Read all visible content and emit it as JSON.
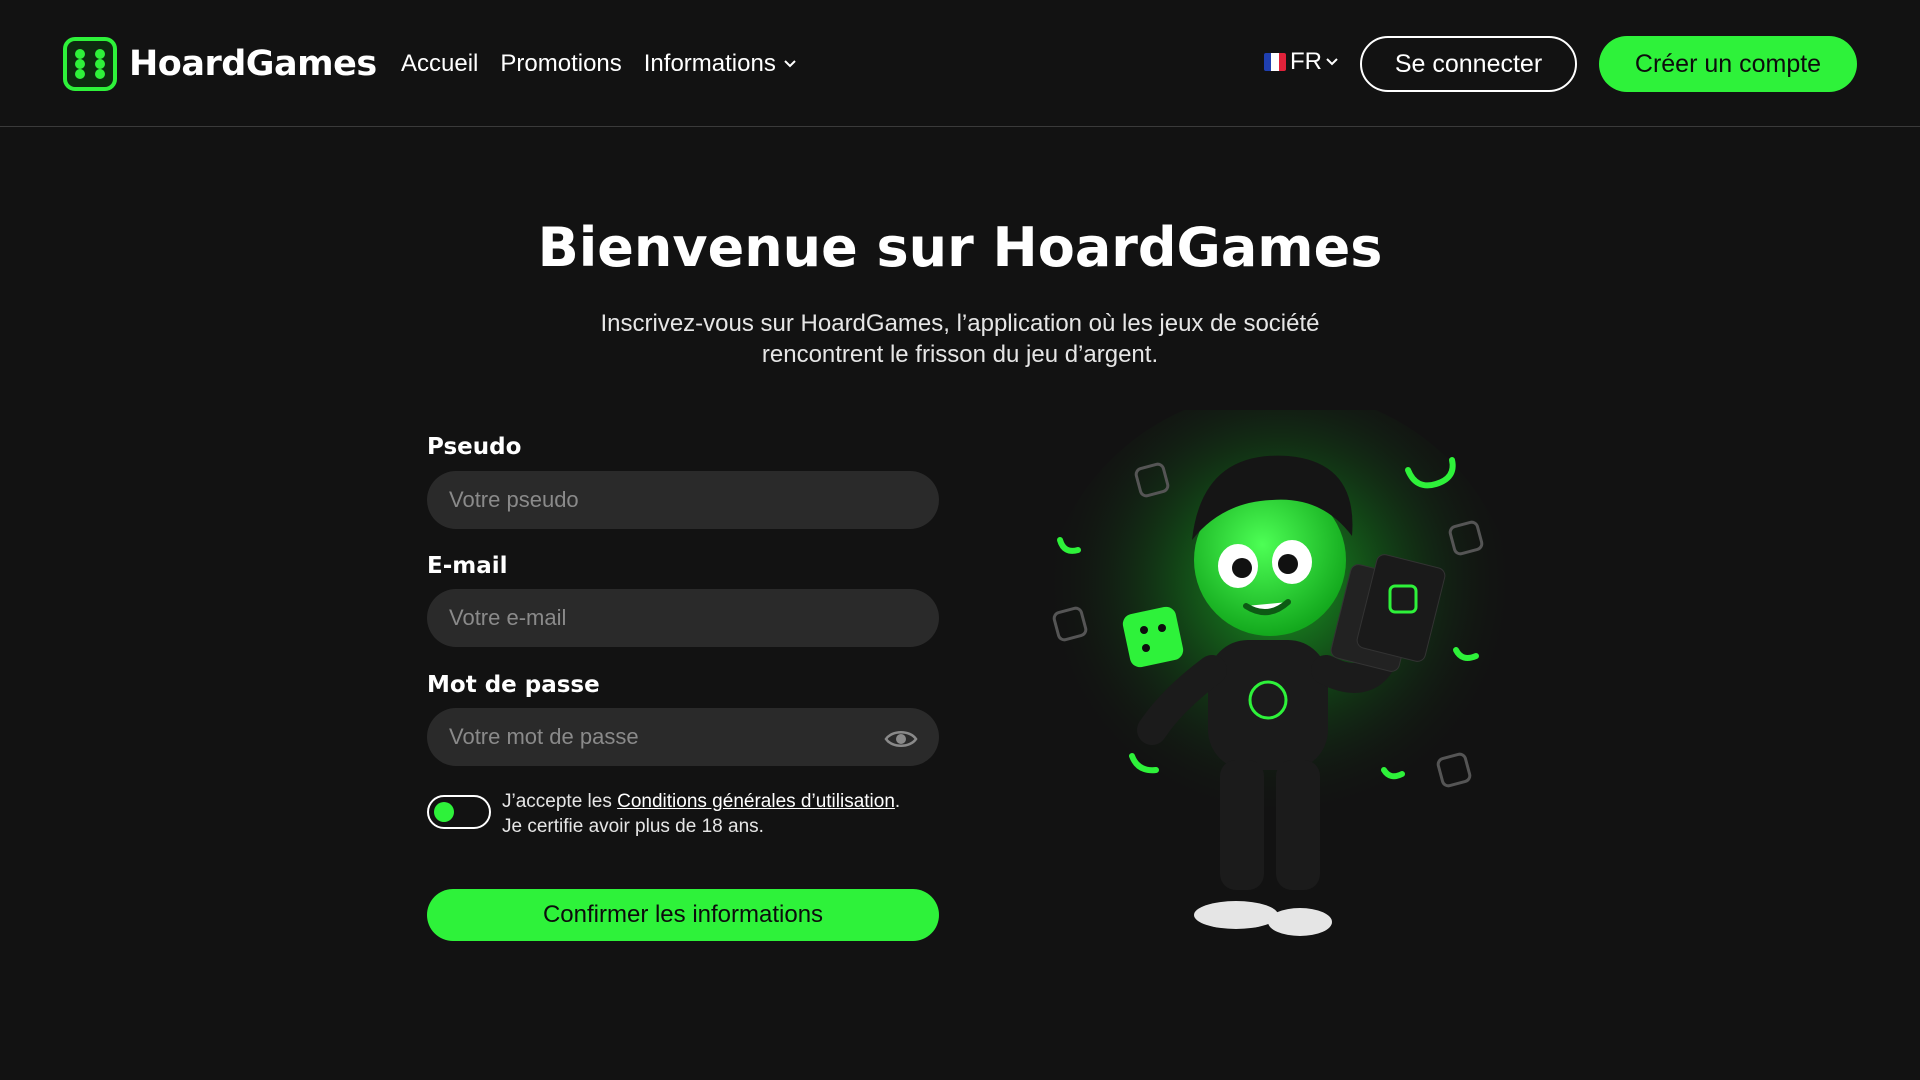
{
  "header": {
    "brand": "HoardGames",
    "nav": [
      {
        "label": "Accueil"
      },
      {
        "label": "Promotions"
      },
      {
        "label": "Informations",
        "has_dropdown": true
      }
    ],
    "language": {
      "code": "FR",
      "flag_colors": [
        "#1f3fb0",
        "#ffffff",
        "#e0223a"
      ]
    },
    "login_label": "Se connecter",
    "signup_label": "Créer un compte"
  },
  "hero": {
    "title": "Bienvenue sur HoardGames",
    "subtitle_line1": "Inscrivez-vous sur HoardGames, l’application où les jeux de société",
    "subtitle_line2": "rencontrent le frisson du jeu d’argent."
  },
  "form": {
    "pseudo": {
      "label": "Pseudo",
      "placeholder": "Votre pseudo",
      "value": ""
    },
    "email": {
      "label": "E-mail",
      "placeholder": "Votre e-mail",
      "value": ""
    },
    "password": {
      "label": "Mot de passe",
      "placeholder": "Votre mot de passe",
      "value": ""
    },
    "terms": {
      "prefix": "J’accepte les ",
      "link": "Conditions générales d’utilisation",
      "suffix": ".",
      "line2": "Je certifie avoir plus de 18 ans.",
      "accepted": true
    },
    "submit_label": "Confirmer les informations"
  },
  "colors": {
    "accent": "#2ef23a",
    "background": "#121212",
    "input_bg": "#2a2a2a"
  },
  "illustration": {
    "icon": "mascot-with-dice-and-cards-illustration"
  }
}
